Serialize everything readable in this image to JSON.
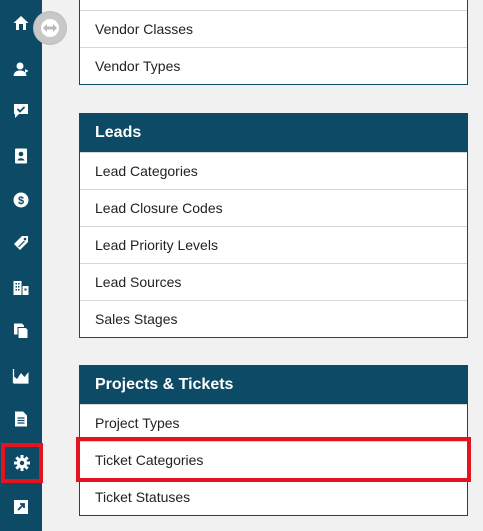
{
  "sidebar": {
    "items": [
      {
        "icon": "home-icon"
      },
      {
        "icon": "contacts-icon"
      },
      {
        "icon": "tasks-icon"
      },
      {
        "icon": "address-book-icon"
      },
      {
        "icon": "dollar-icon"
      },
      {
        "icon": "tag-icon"
      },
      {
        "icon": "buildings-icon"
      },
      {
        "icon": "documents-icon"
      },
      {
        "icon": "chart-icon"
      },
      {
        "icon": "file-icon"
      },
      {
        "icon": "gear-icon",
        "selected": true
      },
      {
        "icon": "external-link-icon"
      }
    ],
    "collapse_icon": "collapse-arrows-icon"
  },
  "panels": {
    "vendors": {
      "items": [
        "Vendor Classes",
        "Vendor Types"
      ]
    },
    "leads": {
      "title": "Leads",
      "items": [
        "Lead Categories",
        "Lead Closure Codes",
        "Lead Priority Levels",
        "Lead Sources",
        "Sales Stages"
      ]
    },
    "projects": {
      "title": "Projects & Tickets",
      "items": [
        "Project Types",
        "Ticket Categories",
        "Ticket Statuses"
      ],
      "highlighted": "Ticket Categories"
    }
  },
  "colors": {
    "navy": "#0d4a66",
    "highlight": "#e3141e",
    "background": "#f1f1f1"
  }
}
